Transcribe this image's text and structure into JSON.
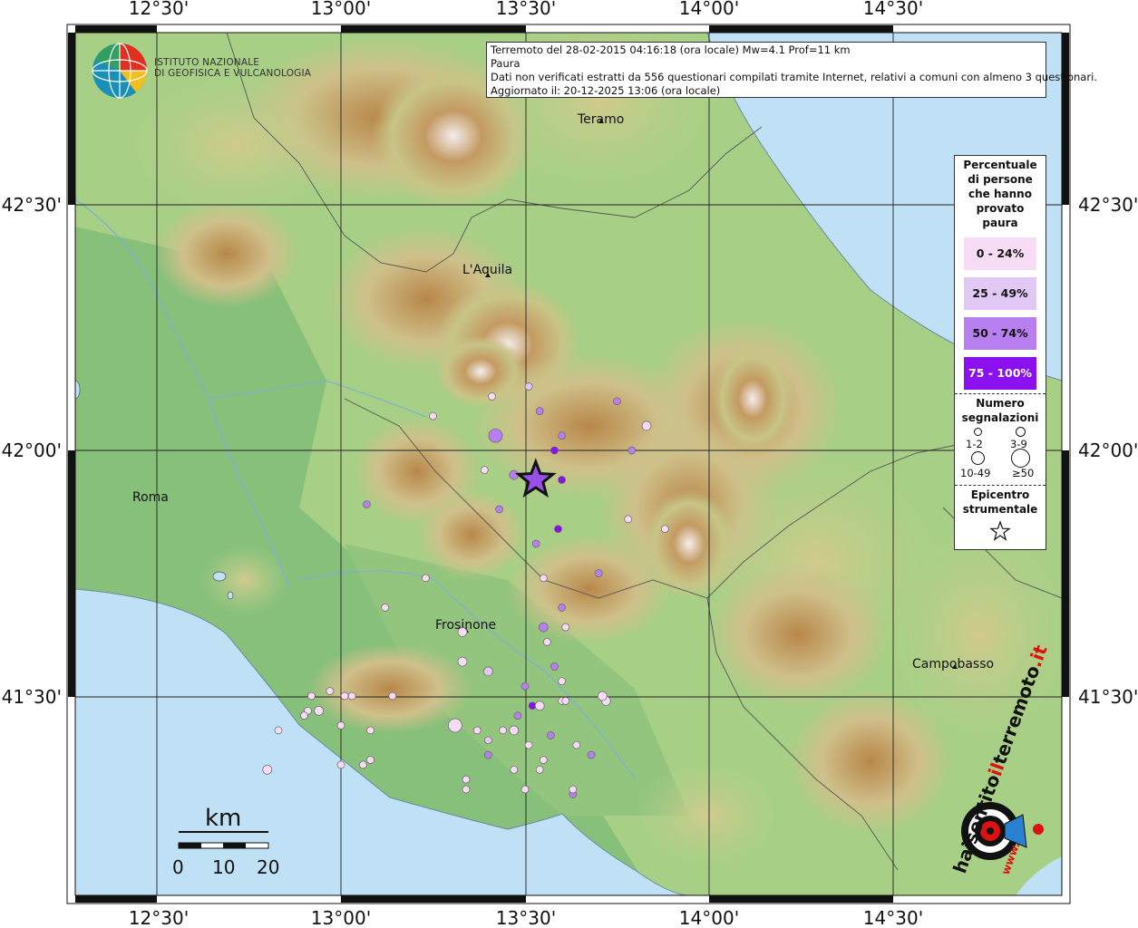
{
  "info": {
    "line1": "Terremoto del 28-02-2015 04:16:18 (ora locale) Mw=4.1 Prof=11 km",
    "line2": "Paura",
    "line3": "Dati non verificati estratti da 556 questionari compilati tramite Internet, relativi a comuni con almeno 3 questionari.",
    "line4": "Aggiornato il: 20-12-2025 13:06 (ora locale)"
  },
  "logo": {
    "line1": "ISTITUTO NAZIONALE",
    "line2": "DI GEOFISICA E VULCANOLOGIA"
  },
  "axes": {
    "lon_labels": [
      "12°30'",
      "13°00'",
      "13°30'",
      "14°00'",
      "14°30'"
    ],
    "lat_labels": [
      "42°30'",
      "42°00'",
      "41°30'"
    ]
  },
  "cities": {
    "teramo": "Teramo",
    "aquila": "L'Aquila",
    "roma": "Roma",
    "frosinone": "Frosinone",
    "campobasso": "Campobasso"
  },
  "legend": {
    "title": [
      "Percentuale",
      "di persone",
      "che hanno",
      "provato",
      "paura"
    ],
    "classes": [
      {
        "label": "0 - 24%",
        "color": "#f8dcf5"
      },
      {
        "label": "25 - 49%",
        "color": "#e2c8f5"
      },
      {
        "label": "50 - 74%",
        "color": "#b77ff0"
      },
      {
        "label": "75 - 100%",
        "color": "#8a10f0"
      }
    ],
    "size_title": [
      "Numero",
      "segnalazioni"
    ],
    "sizes": [
      "1-2",
      "3-9",
      "10-49",
      "≥50"
    ],
    "epicenter_title": [
      "Epicentro",
      "strumentale"
    ]
  },
  "scale": {
    "unit": "km",
    "ticks": [
      "0",
      "10",
      "20"
    ]
  },
  "watermark": {
    "text1": "hai",
    "text2": "sentito",
    "text3": "il",
    "text4": "terremoto",
    "text5": ".it",
    "text6": "www."
  },
  "colors": {
    "sea": "#bfe0f5",
    "lowland": "#8fc57e",
    "hill": "#c9c98a",
    "mountain": "#b8874a",
    "peak": "#f2ecec",
    "epicenter": "#9a50e8"
  },
  "epicenter": {
    "lon": 13.529,
    "lat": 41.94
  },
  "chart_data": {
    "type": "scatter",
    "title": "Paura",
    "xlabel": "",
    "ylabel": "",
    "xlim": [
      12.25,
      14.95
    ],
    "ylim": [
      41.13,
      42.88
    ],
    "points": [
      {
        "lon": 13.51,
        "lat": 42.13,
        "class": 1,
        "size": 1
      },
      {
        "lon": 13.41,
        "lat": 42.11,
        "class": 0,
        "size": 1
      },
      {
        "lon": 13.54,
        "lat": 42.08,
        "class": 2,
        "size": 1
      },
      {
        "lon": 13.75,
        "lat": 42.1,
        "class": 2,
        "size": 1
      },
      {
        "lon": 13.25,
        "lat": 42.07,
        "class": 0,
        "size": 1
      },
      {
        "lon": 13.83,
        "lat": 42.05,
        "class": 0,
        "size": 2
      },
      {
        "lon": 13.42,
        "lat": 42.03,
        "class": 2,
        "size": 3
      },
      {
        "lon": 13.6,
        "lat": 42.03,
        "class": 2,
        "size": 1
      },
      {
        "lon": 13.58,
        "lat": 42.0,
        "class": 3,
        "size": 1
      },
      {
        "lon": 13.79,
        "lat": 42.0,
        "class": 2,
        "size": 1
      },
      {
        "lon": 13.39,
        "lat": 41.96,
        "class": 0,
        "size": 1
      },
      {
        "lon": 13.47,
        "lat": 41.95,
        "class": 2,
        "size": 2
      },
      {
        "lon": 13.53,
        "lat": 41.94,
        "class": 2,
        "size": 1
      },
      {
        "lon": 13.6,
        "lat": 41.94,
        "class": 3,
        "size": 1
      },
      {
        "lon": 13.07,
        "lat": 41.89,
        "class": 2,
        "size": 1
      },
      {
        "lon": 13.43,
        "lat": 41.88,
        "class": 2,
        "size": 1
      },
      {
        "lon": 13.78,
        "lat": 41.86,
        "class": 0,
        "size": 1
      },
      {
        "lon": 13.59,
        "lat": 41.84,
        "class": 3,
        "size": 1
      },
      {
        "lon": 13.88,
        "lat": 41.84,
        "class": 0,
        "size": 1
      },
      {
        "lon": 13.53,
        "lat": 41.81,
        "class": 2,
        "size": 1
      },
      {
        "lon": 13.23,
        "lat": 41.74,
        "class": 0,
        "size": 1
      },
      {
        "lon": 13.55,
        "lat": 41.74,
        "class": 0,
        "size": 1
      },
      {
        "lon": 13.7,
        "lat": 41.75,
        "class": 2,
        "size": 1
      },
      {
        "lon": 13.12,
        "lat": 41.68,
        "class": 0,
        "size": 1
      },
      {
        "lon": 13.33,
        "lat": 41.63,
        "class": 0,
        "size": 2
      },
      {
        "lon": 13.6,
        "lat": 41.68,
        "class": 2,
        "size": 1
      },
      {
        "lon": 13.55,
        "lat": 41.64,
        "class": 2,
        "size": 2
      },
      {
        "lon": 13.56,
        "lat": 41.61,
        "class": 0,
        "size": 1
      },
      {
        "lon": 13.33,
        "lat": 41.57,
        "class": 0,
        "size": 2
      },
      {
        "lon": 13.4,
        "lat": 41.55,
        "class": 1,
        "size": 2
      },
      {
        "lon": 13.5,
        "lat": 41.52,
        "class": 2,
        "size": 1
      },
      {
        "lon": 13.52,
        "lat": 41.48,
        "class": 3,
        "size": 1
      },
      {
        "lon": 13.54,
        "lat": 41.48,
        "class": 0,
        "size": 2
      },
      {
        "lon": 13.57,
        "lat": 41.42,
        "class": 2,
        "size": 1
      },
      {
        "lon": 13.31,
        "lat": 41.44,
        "class": 0,
        "size": 3
      },
      {
        "lon": 13.37,
        "lat": 41.43,
        "class": 0,
        "size": 1
      },
      {
        "lon": 13.4,
        "lat": 41.41,
        "class": 1,
        "size": 1
      },
      {
        "lon": 13.44,
        "lat": 41.43,
        "class": 0,
        "size": 1
      },
      {
        "lon": 13.47,
        "lat": 41.43,
        "class": 0,
        "size": 2
      },
      {
        "lon": 13.51,
        "lat": 41.4,
        "class": 0,
        "size": 1
      },
      {
        "lon": 13.4,
        "lat": 41.38,
        "class": 2,
        "size": 1
      },
      {
        "lon": 13.55,
        "lat": 41.37,
        "class": 0,
        "size": 1
      },
      {
        "lon": 13.47,
        "lat": 41.35,
        "class": 0,
        "size": 1
      },
      {
        "lon": 13.54,
        "lat": 41.35,
        "class": 0,
        "size": 1
      },
      {
        "lon": 13.64,
        "lat": 41.4,
        "class": 0,
        "size": 1
      },
      {
        "lon": 13.68,
        "lat": 41.38,
        "class": 2,
        "size": 1
      },
      {
        "lon": 13.34,
        "lat": 41.33,
        "class": 0,
        "size": 1
      },
      {
        "lon": 13.5,
        "lat": 41.31,
        "class": 0,
        "size": 1
      },
      {
        "lon": 13.63,
        "lat": 41.3,
        "class": 2,
        "size": 1
      },
      {
        "lon": 13.01,
        "lat": 41.5,
        "class": 0,
        "size": 1
      },
      {
        "lon": 12.94,
        "lat": 41.47,
        "class": 0,
        "size": 2
      },
      {
        "lon": 13.72,
        "lat": 41.49,
        "class": 0,
        "size": 2
      },
      {
        "lon": 13.08,
        "lat": 41.37,
        "class": 0,
        "size": 1
      },
      {
        "lon": 13.08,
        "lat": 41.43,
        "class": 0,
        "size": 1
      },
      {
        "lon": 13.14,
        "lat": 41.5,
        "class": 0,
        "size": 1
      },
      {
        "lon": 12.97,
        "lat": 41.51,
        "class": 0,
        "size": 1
      },
      {
        "lon": 12.91,
        "lat": 41.47,
        "class": 0,
        "size": 1
      },
      {
        "lon": 13.0,
        "lat": 41.36,
        "class": 0,
        "size": 1
      },
      {
        "lon": 12.92,
        "lat": 41.5,
        "class": 0,
        "size": 1
      },
      {
        "lon": 13.6,
        "lat": 41.53,
        "class": 0,
        "size": 1
      },
      {
        "lon": 13.48,
        "lat": 41.46,
        "class": 2,
        "size": 1
      },
      {
        "lon": 12.9,
        "lat": 41.46,
        "class": 0,
        "size": 1
      },
      {
        "lon": 13.58,
        "lat": 41.56,
        "class": 2,
        "size": 1
      },
      {
        "lon": 13.61,
        "lat": 41.64,
        "class": 0,
        "size": 1
      },
      {
        "lon": 12.9,
        "lat": 41.46,
        "class": 0,
        "size": 1
      },
      {
        "lon": 12.83,
        "lat": 41.43,
        "class": 0,
        "size": 1
      },
      {
        "lon": 13.03,
        "lat": 41.5,
        "class": 0,
        "size": 1
      },
      {
        "lon": 13.71,
        "lat": 41.5,
        "class": 0,
        "size": 2
      },
      {
        "lon": 13.6,
        "lat": 41.49,
        "class": 0,
        "size": 1
      },
      {
        "lon": 13.61,
        "lat": 41.49,
        "class": 0,
        "size": 1
      },
      {
        "lon": 13.34,
        "lat": 41.31,
        "class": 0,
        "size": 1
      },
      {
        "lon": 13.0,
        "lat": 41.44,
        "class": 0,
        "size": 1
      },
      {
        "lon": 13.06,
        "lat": 41.36,
        "class": 0,
        "size": 1
      },
      {
        "lon": 12.8,
        "lat": 41.35,
        "class": 0,
        "size": 2
      },
      {
        "lon": 13.63,
        "lat": 41.31,
        "class": 0,
        "size": 1
      }
    ]
  }
}
